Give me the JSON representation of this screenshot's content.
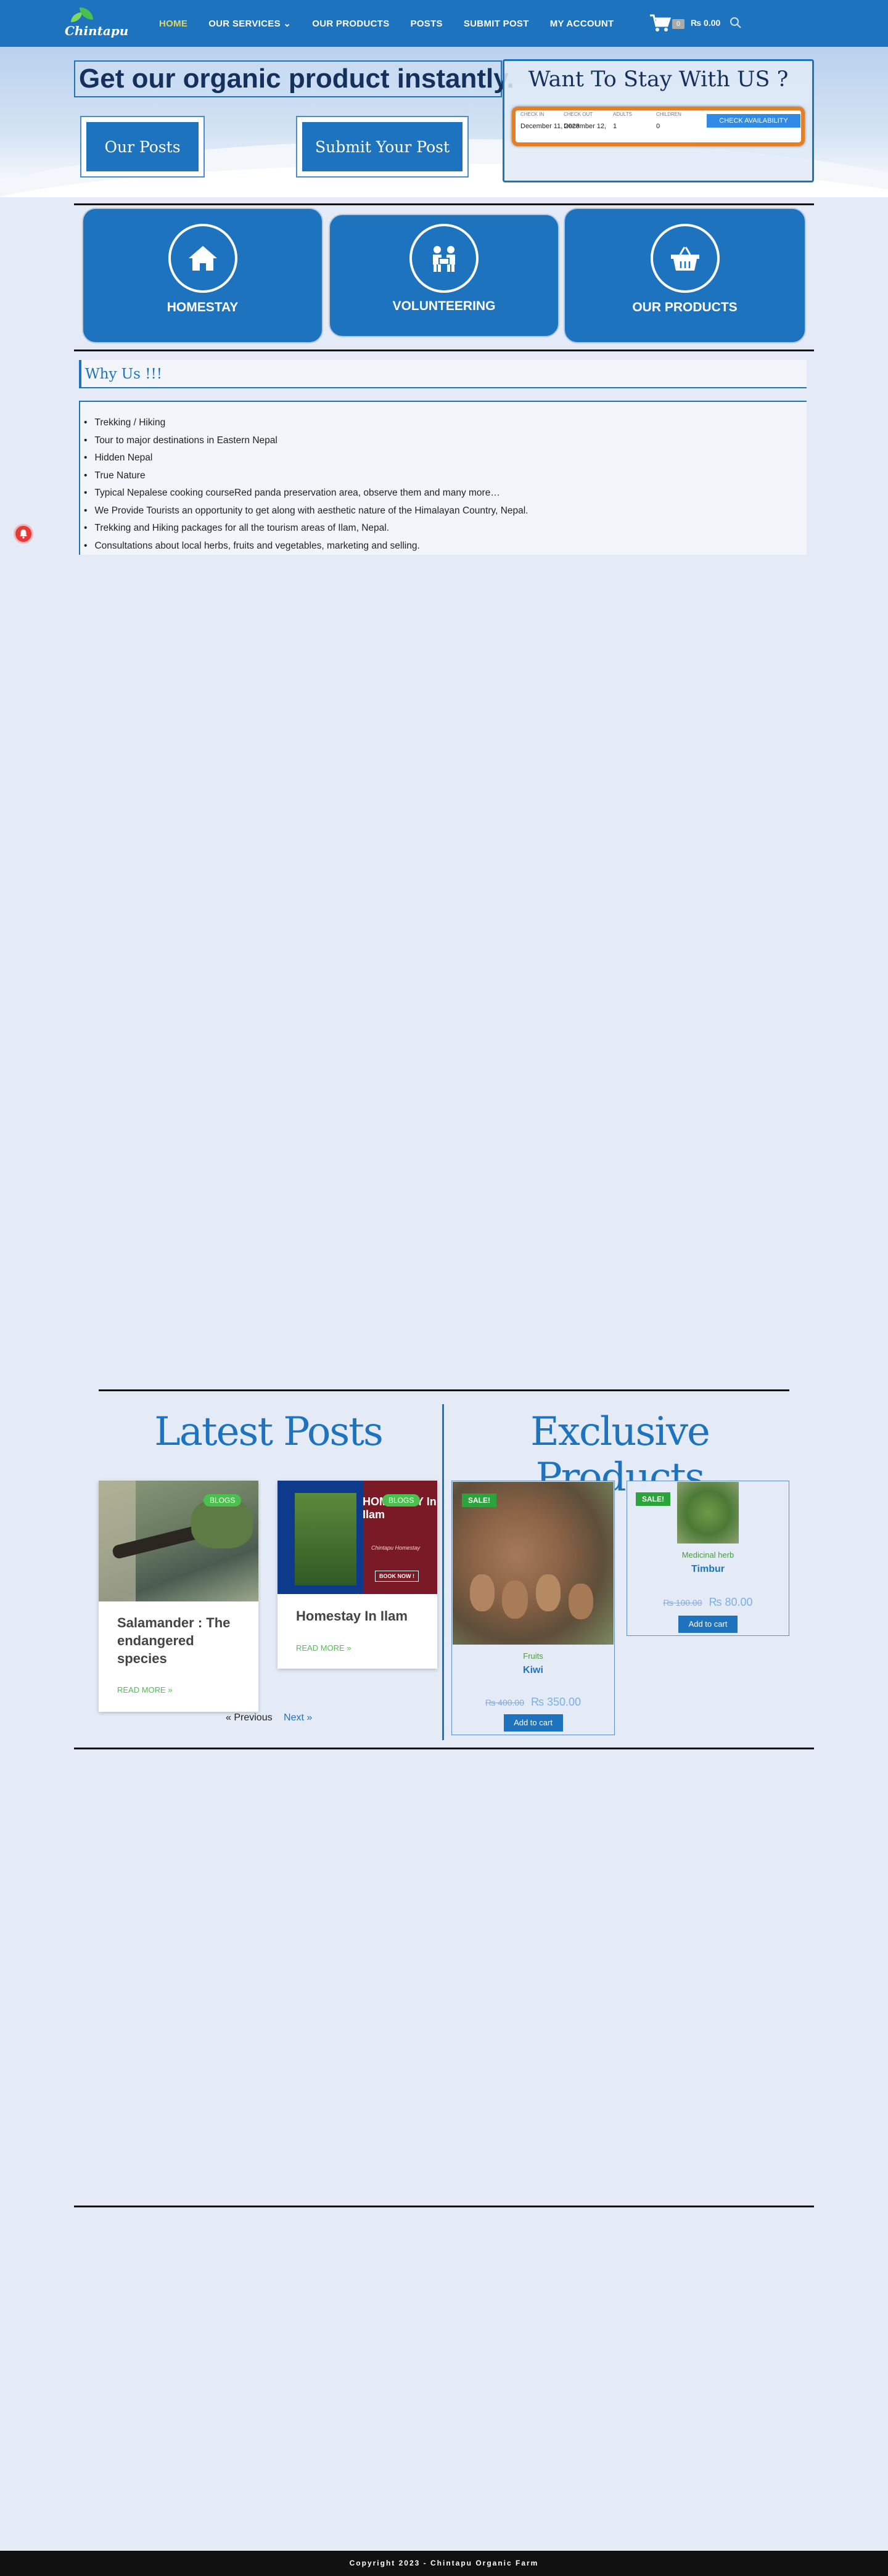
{
  "header": {
    "logo_text": "Chintapu",
    "nav": [
      {
        "label": "HOME"
      },
      {
        "label": "OUR SERVICES ⌄"
      },
      {
        "label": "OUR PRODUCTS"
      },
      {
        "label": "POSTS"
      },
      {
        "label": "SUBMIT POST"
      },
      {
        "label": "MY ACCOUNT"
      }
    ],
    "cart_count": "0",
    "cart_total": "₨ 0.00",
    "icons": {
      "cart": "cart-icon",
      "search": "search-icon"
    }
  },
  "hero": {
    "title": "Get our organic product instantly.",
    "buttons": {
      "posts": "Our Posts",
      "submit": "Submit Your Post"
    }
  },
  "booking": {
    "title": "Want To Stay With US ?",
    "labels": {
      "check_in": "CHECK IN",
      "check_out": "CHECK OUT",
      "adults": "ADULTS",
      "children": "CHILDREN"
    },
    "values": {
      "check_in": "December 11, 2023",
      "check_out": "December 12, 2023",
      "adults": "1",
      "children": "0"
    },
    "button": "CHECK AVAILABILITY"
  },
  "services": [
    {
      "label": "HOMESTAY",
      "icon": "home-icon"
    },
    {
      "label": "VOLUNTEERING",
      "icon": "volunteers-icon"
    },
    {
      "label": "OUR PRODUCTS",
      "icon": "basket-icon"
    }
  ],
  "why": {
    "title": "Why Us !!!",
    "items": [
      "Trekking / Hiking",
      "Tour to major destinations in Eastern Nepal",
      "Hidden Nepal",
      "True Nature",
      "Typical Nepalese cooking courseRed panda preservation area, observe them and many more…",
      "We Provide Tourists an opportunity to get along with aesthetic nature of the Himalayan Country, Nepal.",
      "Trekking and Hiking packages for all the tourism areas of Ilam, Nepal.",
      "Consultations about local herbs, fruits and vegetables, marketing and selling."
    ]
  },
  "latest": {
    "title": "Latest Posts",
    "posts": [
      {
        "badge": "BLOGS",
        "title": "Salamander : The endangered species",
        "read_more": "READ MORE »"
      },
      {
        "badge": "BLOGS",
        "title": "Homestay In Ilam",
        "read_more": "READ MORE »",
        "image_text": "HOMESTAY In Ilam",
        "image_sub": "Chintapu Homestay",
        "image_btn": "BOOK NOW !"
      }
    ],
    "pagination": {
      "prev": "« Previous",
      "next": "Next »"
    }
  },
  "exclusive": {
    "title": "Exclusive Products",
    "products": [
      {
        "sale": "SALE!",
        "category": "Fruits",
        "name": "Kiwi",
        "old_price": "₨ 400.00",
        "price": "₨ 350.00",
        "button": "Add to cart"
      },
      {
        "sale": "SALE!",
        "category": "Medicinal herb",
        "name": "Timbur",
        "old_price": "₨ 100.00",
        "price": "₨ 80.00",
        "button": "Add to cart"
      }
    ]
  },
  "footer": {
    "text": "Copyright 2023 - Chintapu Organic Farm"
  },
  "colors": {
    "brand": "#1e73be",
    "accent": "#4cc04e",
    "orange": "#e77e23",
    "bg": "#e4ebf6"
  }
}
